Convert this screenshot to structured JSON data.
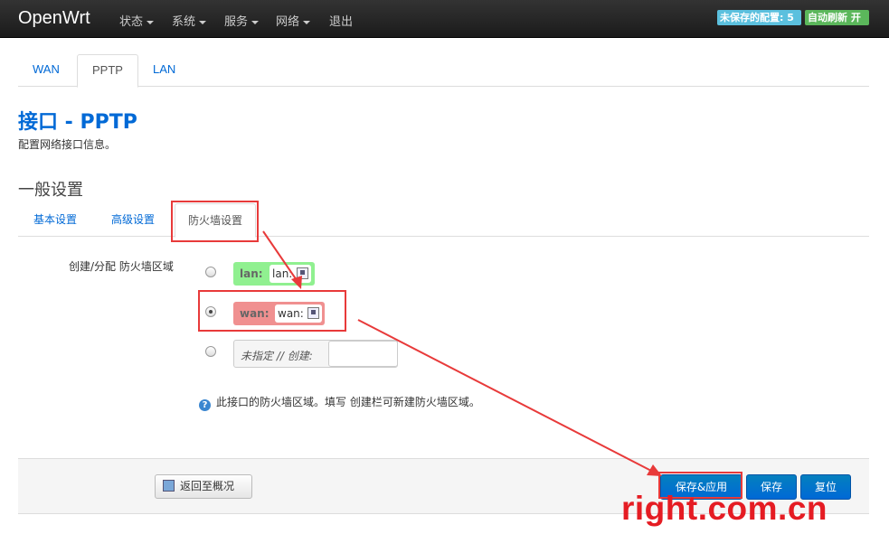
{
  "navbar": {
    "brand": "OpenWrt",
    "menus": [
      {
        "label": "状态",
        "dropdown": true
      },
      {
        "label": "系统",
        "dropdown": true
      },
      {
        "label": "服务",
        "dropdown": true
      },
      {
        "label": "网络",
        "dropdown": true
      },
      {
        "label": "退出",
        "dropdown": false
      }
    ],
    "unsaved_badge": "未保存的配置: 5",
    "auto_refresh_badge": "自动刷新 开"
  },
  "interface_tabs": [
    "WAN",
    "PPTP",
    "LAN"
  ],
  "active_interface_tab": "PPTP",
  "page": {
    "title": "接口 - PPTP",
    "description": "配置网络接口信息。"
  },
  "section": {
    "title": "一般设置",
    "tabs": [
      "基本设置",
      "高级设置",
      "防火墙设置"
    ],
    "active_tab": "防火墙设置"
  },
  "firewall": {
    "field_label": "创建/分配 防火墙区域",
    "zones": [
      {
        "name": "lan:",
        "chip": "lan:",
        "selected": false,
        "color": "#90f090"
      },
      {
        "name": "wan:",
        "chip": "wan:",
        "selected": true,
        "color": "#f09090"
      }
    ],
    "create_label": "未指定 // 创建:",
    "create_value": "",
    "help_text": "此接口的防火墙区域。填写 创建栏可新建防火墙区域。"
  },
  "footer": {
    "back_button": "返回至概况",
    "save_apply_button": "保存&应用",
    "save_button": "保存",
    "reset_button": "复位"
  },
  "watermark": "right.com.cn",
  "colors": {
    "link": "#0069d6",
    "button": "#0069d6",
    "annotation": "#e83a3a",
    "watermark": "#e51c23"
  }
}
